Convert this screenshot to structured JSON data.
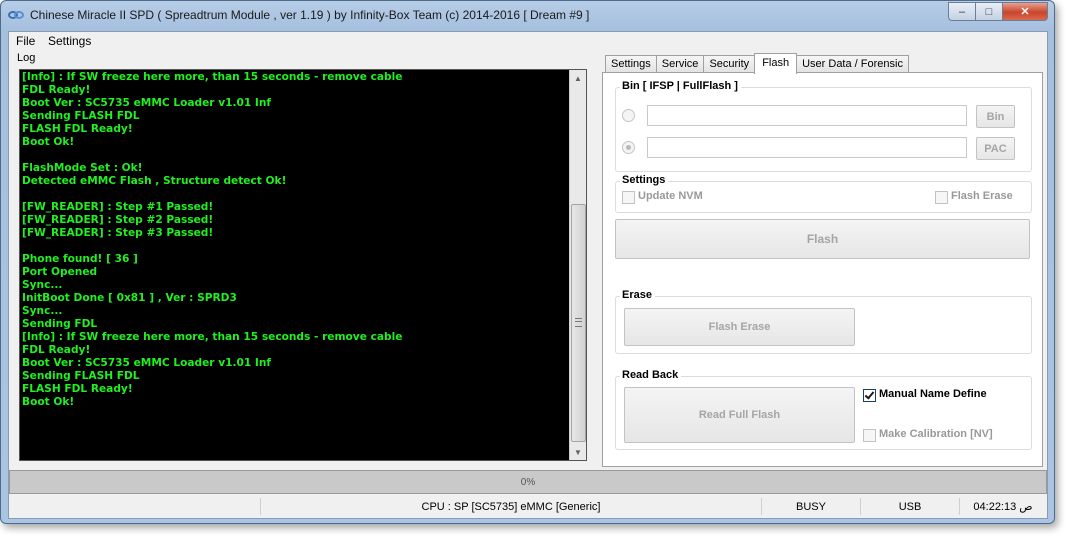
{
  "window": {
    "title": "Chinese Miracle II SPD ( Spreadtrum Module , ver 1.19 ) by Infinity-Box Team (c) 2014-2016 [ Dream #9 ]",
    "minimize_glyph": "–",
    "maximize_glyph": "□",
    "close_glyph": "✕"
  },
  "menu": {
    "items": [
      "File",
      "Settings"
    ]
  },
  "log": {
    "label": "Log",
    "lines": [
      "[Info] : If SW freeze here more, than 15 seconds - remove cable",
      "FDL Ready!",
      "Boot Ver : SC5735 eMMC Loader v1.01 Inf",
      "Sending FLASH FDL",
      "FLASH FDL Ready!",
      "Boot Ok!",
      "",
      "FlashMode Set : Ok!",
      "Detected eMMC Flash , Structure detect Ok!",
      "",
      "[FW_READER] : Step #1 Passed!",
      "[FW_READER] : Step #2 Passed!",
      "[FW_READER] : Step #3 Passed!",
      "",
      "Phone found! [ 36 ]",
      "Port Opened",
      "Sync...",
      "InitBoot Done [ 0x81 ] , Ver : SPRD3",
      "Sync...",
      "Sending FDL",
      "[Info] : If SW freeze here more, than 15 seconds - remove cable",
      "FDL Ready!",
      "Boot Ver : SC5735 eMMC Loader v1.01 Inf",
      "Sending FLASH FDL",
      "FLASH FDL Ready!",
      "Boot Ok!"
    ],
    "text_color": "#22ee22"
  },
  "tabs": [
    "Settings",
    "Service",
    "Security",
    "Flash",
    "User Data / Forensic"
  ],
  "active_tab": "Flash",
  "flash_panel": {
    "bin_group": {
      "label": "Bin  [ IFSP | FullFlash ]",
      "bin_button": "Bin",
      "pac_button": "PAC",
      "bin_path": "",
      "pac_path": ""
    },
    "settings_group": {
      "label": "Settings",
      "update_nvm": "Update NVM",
      "flash_erase": "Flash Erase"
    },
    "flash_button": "Flash",
    "erase_group": {
      "label": "Erase",
      "button": "Flash Erase"
    },
    "read_back_group": {
      "label": "Read Back",
      "button": "Read Full Flash",
      "manual_name_define": "Manual Name Define",
      "manual_name_define_checked": true,
      "make_calibration": "Make Calibration [NV]",
      "make_calibration_checked": false
    }
  },
  "progress": {
    "label": "0%",
    "value": 0
  },
  "statusbar": {
    "cpu": "CPU : SP [SC5735] eMMC [Generic]",
    "state": "BUSY",
    "port": "USB",
    "time": "04:22:13 ص"
  }
}
